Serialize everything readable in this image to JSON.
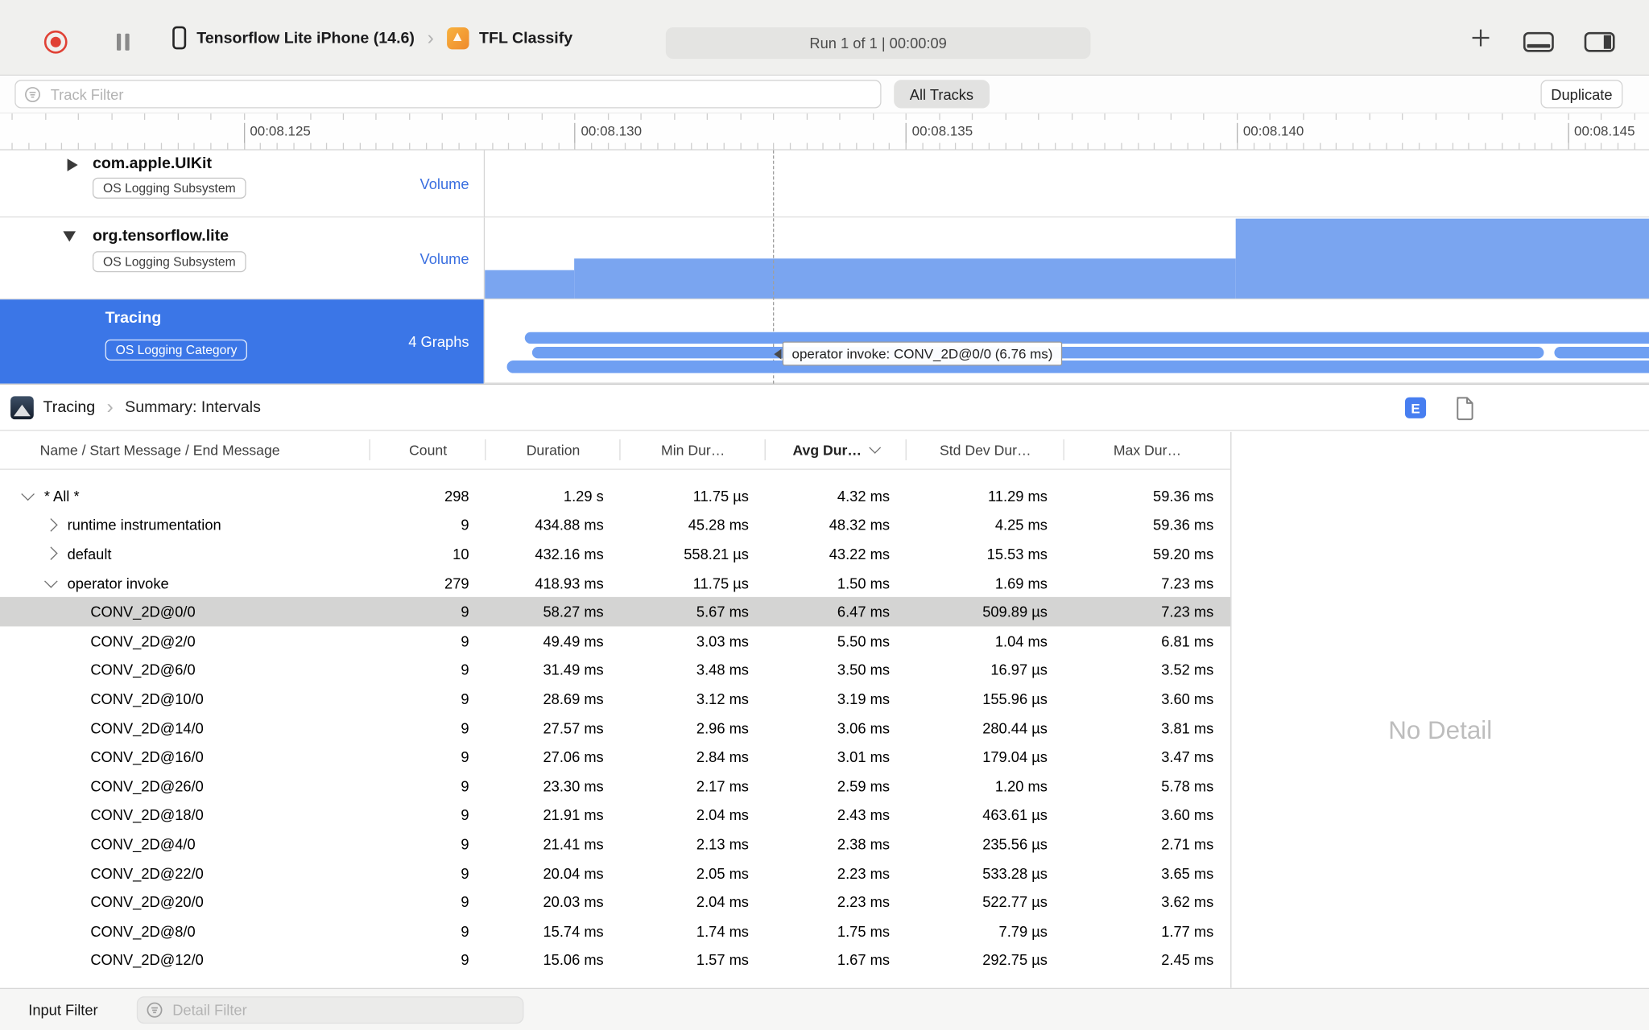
{
  "colors": {
    "accent_blue": "#3b76e7",
    "graph_fill_blue": "#7aa5f0",
    "lane_blue": "#6f9ff2",
    "record_red": "#e04135",
    "selected_row_gray": "#d4d4d3",
    "volume_label_blue": "#3a6fe0"
  },
  "icons": {
    "chevron": "›"
  },
  "toolbar": {
    "device_name": "Tensorflow Lite iPhone (14.6)",
    "app_name": "TFL Classify",
    "run_status": "Run 1 of 1  |  00:00:09"
  },
  "filter_bar": {
    "track_filter_placeholder": "Track Filter",
    "all_tracks_label": "All Tracks",
    "duplicate_label": "Duplicate"
  },
  "timeline": {
    "tick_labels": [
      "00:08.125",
      "00:08.130",
      "00:08.135",
      "00:08.140",
      "00:08.145"
    ]
  },
  "tracks": [
    {
      "name": "com.apple.UIKit",
      "badge": "OS Logging Subsystem",
      "meta": "Volume",
      "state": "collapsed"
    },
    {
      "name": "org.tensorflow.lite",
      "badge": "OS Logging Subsystem",
      "meta": "Volume",
      "state": "expanded"
    },
    {
      "name": "Tracing",
      "badge": "OS Logging Category",
      "meta": "4 Graphs",
      "state": "selected"
    }
  ],
  "tooltip": {
    "text": "operator invoke: CONV_2D@0/0 (6.76 ms)"
  },
  "detail_header": {
    "root": "Tracing",
    "view": "Summary: Intervals",
    "e_badge": "E"
  },
  "table": {
    "columns": [
      "Name / Start Message / End Message",
      "Count",
      "Duration",
      "Min Dur…",
      "Avg Dur…",
      "Std Dev Dur…",
      "Max Dur…"
    ],
    "sorted_column": "Avg Dur…",
    "rows": [
      {
        "name": "* All *",
        "count": "298",
        "duration": "1.29 s",
        "min": "11.75 µs",
        "avg": "4.32 ms",
        "std": "11.29 ms",
        "max": "59.36 ms",
        "indent": 0,
        "chevron": "down",
        "selected": false
      },
      {
        "name": "runtime instrumentation",
        "count": "9",
        "duration": "434.88 ms",
        "min": "45.28 ms",
        "avg": "48.32 ms",
        "std": "4.25 ms",
        "max": "59.36 ms",
        "indent": 1,
        "chevron": "right",
        "selected": false
      },
      {
        "name": "default",
        "count": "10",
        "duration": "432.16 ms",
        "min": "558.21 µs",
        "avg": "43.22 ms",
        "std": "15.53 ms",
        "max": "59.20 ms",
        "indent": 1,
        "chevron": "right",
        "selected": false
      },
      {
        "name": "operator invoke",
        "count": "279",
        "duration": "418.93 ms",
        "min": "11.75 µs",
        "avg": "1.50 ms",
        "std": "1.69 ms",
        "max": "7.23 ms",
        "indent": 1,
        "chevron": "down",
        "selected": false
      },
      {
        "name": "CONV_2D@0/0",
        "count": "9",
        "duration": "58.27 ms",
        "min": "5.67 ms",
        "avg": "6.47 ms",
        "std": "509.89 µs",
        "max": "7.23 ms",
        "indent": 2,
        "chevron": "none",
        "selected": true
      },
      {
        "name": "CONV_2D@2/0",
        "count": "9",
        "duration": "49.49 ms",
        "min": "3.03 ms",
        "avg": "5.50 ms",
        "std": "1.04 ms",
        "max": "6.81 ms",
        "indent": 2,
        "chevron": "none",
        "selected": false
      },
      {
        "name": "CONV_2D@6/0",
        "count": "9",
        "duration": "31.49 ms",
        "min": "3.48 ms",
        "avg": "3.50 ms",
        "std": "16.97 µs",
        "max": "3.52 ms",
        "indent": 2,
        "chevron": "none",
        "selected": false
      },
      {
        "name": "CONV_2D@10/0",
        "count": "9",
        "duration": "28.69 ms",
        "min": "3.12 ms",
        "avg": "3.19 ms",
        "std": "155.96 µs",
        "max": "3.60 ms",
        "indent": 2,
        "chevron": "none",
        "selected": false
      },
      {
        "name": "CONV_2D@14/0",
        "count": "9",
        "duration": "27.57 ms",
        "min": "2.96 ms",
        "avg": "3.06 ms",
        "std": "280.44 µs",
        "max": "3.81 ms",
        "indent": 2,
        "chevron": "none",
        "selected": false
      },
      {
        "name": "CONV_2D@16/0",
        "count": "9",
        "duration": "27.06 ms",
        "min": "2.84 ms",
        "avg": "3.01 ms",
        "std": "179.04 µs",
        "max": "3.47 ms",
        "indent": 2,
        "chevron": "none",
        "selected": false
      },
      {
        "name": "CONV_2D@26/0",
        "count": "9",
        "duration": "23.30 ms",
        "min": "2.17 ms",
        "avg": "2.59 ms",
        "std": "1.20 ms",
        "max": "5.78 ms",
        "indent": 2,
        "chevron": "none",
        "selected": false
      },
      {
        "name": "CONV_2D@18/0",
        "count": "9",
        "duration": "21.91 ms",
        "min": "2.04 ms",
        "avg": "2.43 ms",
        "std": "463.61 µs",
        "max": "3.60 ms",
        "indent": 2,
        "chevron": "none",
        "selected": false
      },
      {
        "name": "CONV_2D@4/0",
        "count": "9",
        "duration": "21.41 ms",
        "min": "2.13 ms",
        "avg": "2.38 ms",
        "std": "235.56 µs",
        "max": "2.71 ms",
        "indent": 2,
        "chevron": "none",
        "selected": false
      },
      {
        "name": "CONV_2D@22/0",
        "count": "9",
        "duration": "20.04 ms",
        "min": "2.05 ms",
        "avg": "2.23 ms",
        "std": "533.28 µs",
        "max": "3.65 ms",
        "indent": 2,
        "chevron": "none",
        "selected": false
      },
      {
        "name": "CONV_2D@20/0",
        "count": "9",
        "duration": "20.03 ms",
        "min": "2.04 ms",
        "avg": "2.23 ms",
        "std": "522.77 µs",
        "max": "3.62 ms",
        "indent": 2,
        "chevron": "none",
        "selected": false
      },
      {
        "name": "CONV_2D@8/0",
        "count": "9",
        "duration": "15.74 ms",
        "min": "1.74 ms",
        "avg": "1.75 ms",
        "std": "7.79 µs",
        "max": "1.77 ms",
        "indent": 2,
        "chevron": "none",
        "selected": false
      },
      {
        "name": "CONV_2D@12/0",
        "count": "9",
        "duration": "15.06 ms",
        "min": "1.57 ms",
        "avg": "1.67 ms",
        "std": "292.75 µs",
        "max": "2.45 ms",
        "indent": 2,
        "chevron": "none",
        "selected": false
      }
    ]
  },
  "right_panel": {
    "empty_text": "No Detail"
  },
  "bottom_bar": {
    "label": "Input Filter",
    "detail_filter_placeholder": "Detail Filter"
  }
}
